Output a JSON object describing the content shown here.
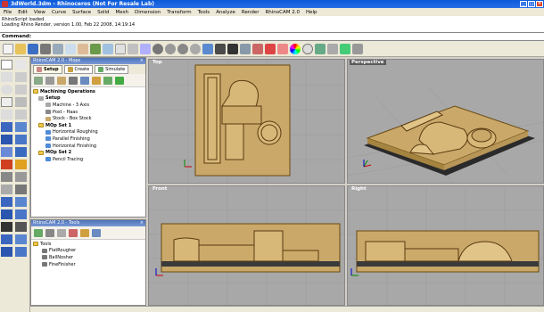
{
  "window": {
    "title": "3dWorld.3dm - Rhinoceros (Not For Resale Lab)"
  },
  "menu": [
    "File",
    "Edit",
    "View",
    "Curve",
    "Surface",
    "Solid",
    "Mesh",
    "Dimension",
    "Transform",
    "Tools",
    "Analyze",
    "Render",
    "RhinoCAM 2.0",
    "Help"
  ],
  "output": {
    "line1": "RhinoScript loaded.",
    "line2": "Loading Rhino Render, version 1.00, Feb 22 2008, 14:19:14"
  },
  "command": {
    "label": "Command:"
  },
  "mops_panel": {
    "title": "RhinoCAM 2.0 - Mops",
    "tabs": [
      "Setup",
      "Create",
      "Simulate"
    ],
    "tree": {
      "root": "Machining Operations",
      "setup": "Setup",
      "machine": "Machine - 3 Axis",
      "post": "Post - Haas",
      "stock": "Stock - Box Stock",
      "mopset1": "MOp Set 1",
      "horizontal_roughing": "Horizontal Roughing",
      "parallel_finishing": "Parallel Finishing",
      "horizontal_finishing": "Horizontal Finishing",
      "mopset2": "MOp Set 2",
      "pencil_tracing": "Pencil Tracing"
    }
  },
  "tools_panel": {
    "title": "RhinoCAM 2.0 - Tools",
    "tree": {
      "root": "Tools",
      "t1": "FlatRougher",
      "t2": "BallNosher",
      "t3": "FineFinisher"
    }
  },
  "viewports": {
    "top": "Top",
    "perspective": "Perspective",
    "front": "Front",
    "right": "Right"
  },
  "colors": {
    "part_tan": "#c9a86a",
    "part_dark": "#8a6a30",
    "viewport_bg": "#a8a8a8",
    "active_label": "#5a5a5a"
  }
}
